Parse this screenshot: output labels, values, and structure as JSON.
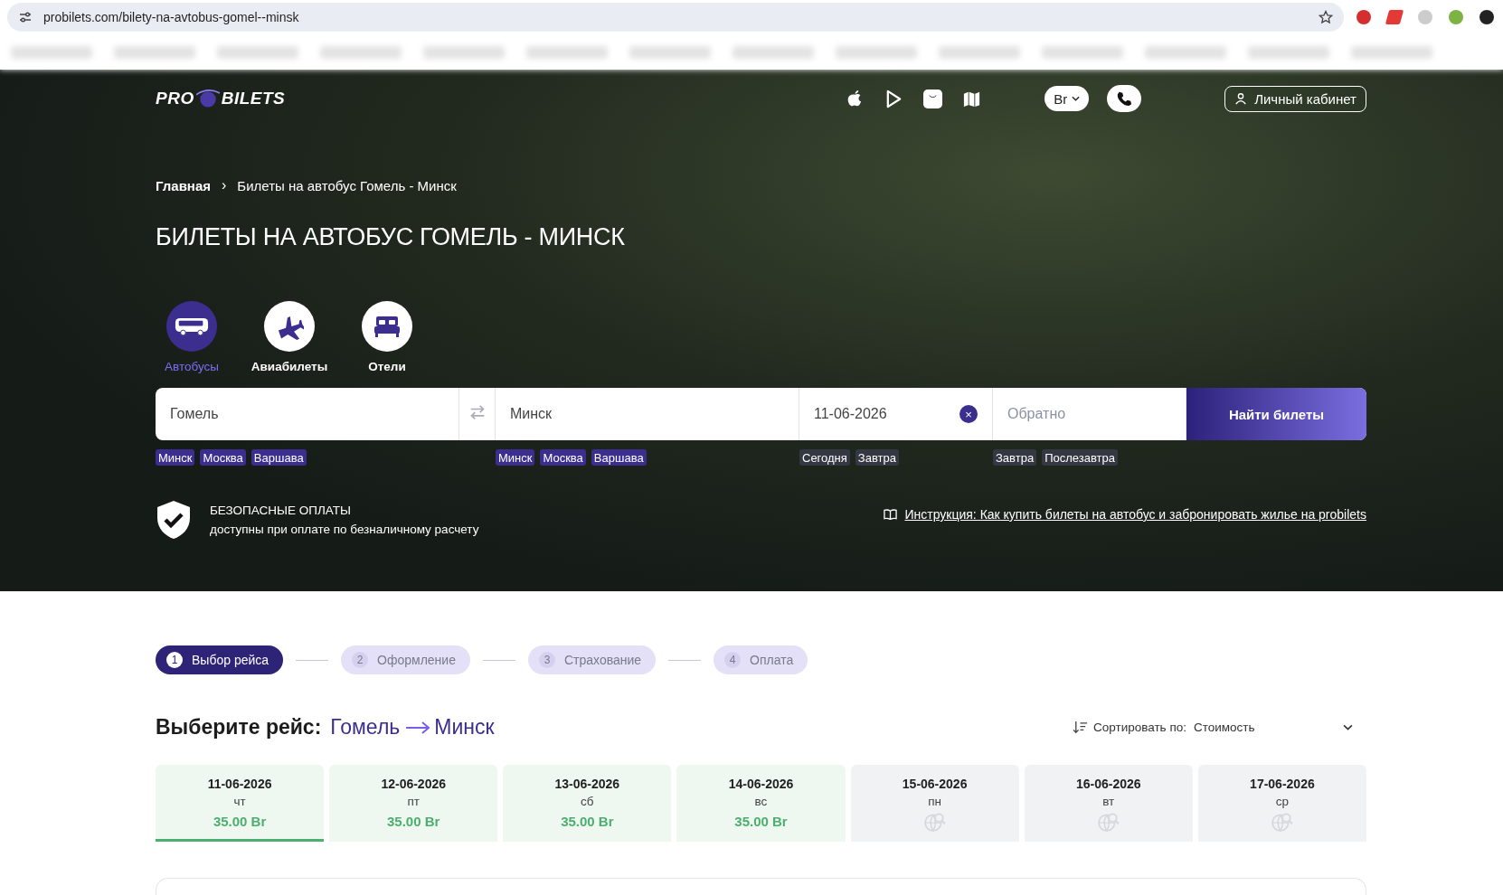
{
  "browser": {
    "url": "probilets.com/bilety-na-avtobus-gomel--minsk"
  },
  "header": {
    "logo": [
      "PRO",
      "BILETS"
    ],
    "currency": "Br",
    "account": "Личный кабинет"
  },
  "breadcrumb_separator": "›",
  "date_clear": "×",
  "breadcrumbs": [
    {
      "label": "Главная",
      "current": false
    },
    {
      "label": "Билеты на автобус Гомель - Минск",
      "current": true
    }
  ],
  "title": "БИЛЕТЫ НА АВТОБУС ГОМЕЛЬ - МИНСК",
  "transport_tabs": [
    {
      "kind": "bus",
      "label": "Автобусы",
      "selected": true
    },
    {
      "kind": "plane",
      "label": "Авиабилеты",
      "selected": false
    },
    {
      "kind": "hotel",
      "label": "Отели",
      "selected": false
    }
  ],
  "search": {
    "from": {
      "value": "Гомель",
      "tags": [
        "Минск",
        "Москва",
        "Варшава"
      ]
    },
    "to": {
      "value": "Минск",
      "tags": [
        "Минск",
        "Москва",
        "Варшава"
      ]
    },
    "date": {
      "value": "11-06-2026",
      "tags": [
        "Сегодня",
        "Завтра"
      ]
    },
    "return": {
      "placeholder": "Обратно",
      "tags": [
        "Завтра",
        "Послезавтра"
      ]
    },
    "button": "Найти билеты"
  },
  "security": {
    "title": "БЕЗОПАСНЫЕ ОПЛАТЫ",
    "text": "доступны при оплате по безналичному расчету"
  },
  "instruction_link": "Инструкция: Как купить билеты на автобус и забронировать жилье на probilets",
  "steps": [
    {
      "number": "1",
      "label": "Выбор рейса",
      "selected": true
    },
    {
      "number": "2",
      "label": "Оформление",
      "selected": false
    },
    {
      "number": "3",
      "label": "Страхование",
      "selected": false
    },
    {
      "number": "4",
      "label": "Оплата",
      "selected": false
    }
  ],
  "route": {
    "heading": "Выберите рейс:",
    "from": "Гомель",
    "to": "Минск"
  },
  "sort": {
    "label": "Сортировать по:",
    "value": "Стоимость"
  },
  "dates": [
    {
      "date": "11-06-2026",
      "weekday": "чт",
      "price": "35.00 Br",
      "selected": true
    },
    {
      "date": "12-06-2026",
      "weekday": "пт",
      "price": "35.00 Br",
      "selected": false
    },
    {
      "date": "13-06-2026",
      "weekday": "сб",
      "price": "35.00 Br",
      "selected": false
    },
    {
      "date": "14-06-2026",
      "weekday": "вс",
      "price": "35.00 Br",
      "selected": false
    },
    {
      "date": "15-06-2026",
      "weekday": "пн",
      "selected": false
    },
    {
      "date": "16-06-2026",
      "weekday": "вт",
      "selected": false
    },
    {
      "date": "17-06-2026",
      "weekday": "ср",
      "selected": false
    }
  ]
}
